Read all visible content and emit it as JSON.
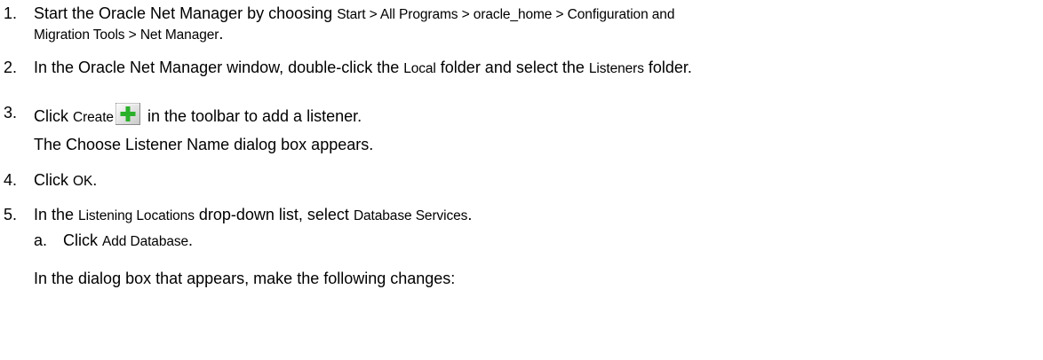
{
  "steps": [
    {
      "num": "1.",
      "line1_text": "Start the Oracle Net Manager by choosing ",
      "line1_ui": "Start > All Programs > oracle_home > Configuration and",
      "line2_ui": "Migration Tools > Net Manager",
      "line2_end": "."
    },
    {
      "num": "2.",
      "t1": "In the Oracle Net Manager window, double-click the ",
      "ui1": "Local",
      "t2": " folder and select the ",
      "ui2": "Listeners",
      "t3": " folder."
    },
    {
      "num": "3.",
      "t1": "Click ",
      "ui1": "Create",
      "t2": " in the toolbar to add a listener.",
      "icon": "create-plus-icon",
      "icon_color": "#2bb02b",
      "note": "The Choose Listener Name dialog box appears."
    },
    {
      "num": "4.",
      "t1": "Click ",
      "ui1": "OK",
      "t2": "."
    },
    {
      "num": "5.",
      "t1": "In the ",
      "ui1": "Listening Locations",
      "t2": " drop-down list, select ",
      "ui2": "Database Services",
      "t3": "."
    }
  ],
  "substep": {
    "letter": "a.",
    "t1": "Click ",
    "ui1": "Add Database",
    "t2": "."
  },
  "closing": "In the dialog box that appears, make the following changes:"
}
